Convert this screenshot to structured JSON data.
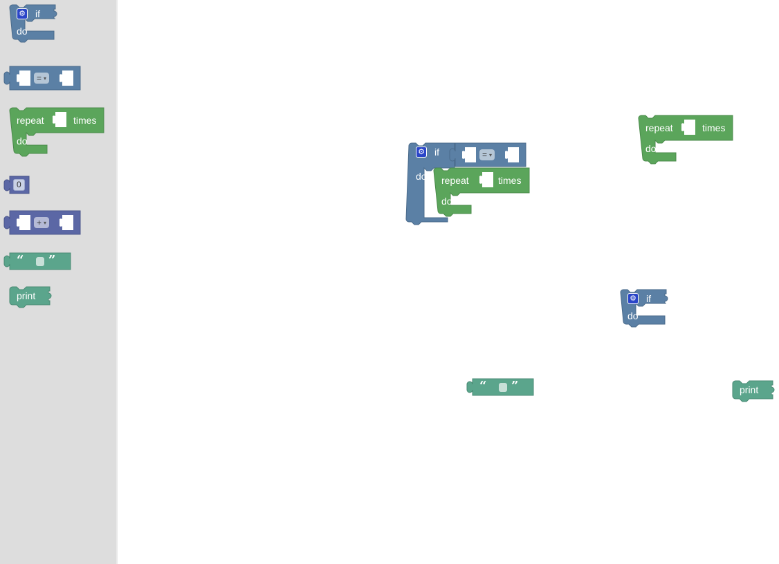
{
  "colors": {
    "logic": "#5b80a5",
    "loop": "#5ba55b",
    "math": "#5b67a5",
    "text": "#5ba58c",
    "toolbox_bg": "#dddddd",
    "workspace_bg": "#ffffff"
  },
  "toolbox": {
    "if_block": {
      "if_label": "if",
      "do_label": "do",
      "icon": "gear-icon"
    },
    "compare_block": {
      "operator": "="
    },
    "repeat_block": {
      "repeat_label": "repeat",
      "times_label": "times",
      "do_label": "do"
    },
    "number_block": {
      "value": "0"
    },
    "arithmetic_block": {
      "operator": "+"
    },
    "text_block": {
      "open_quote": "“",
      "close_quote": "”"
    },
    "print_block": {
      "label": "print"
    }
  },
  "workspace": {
    "if_group": {
      "if_label": "if",
      "do_label": "do",
      "operator": "=",
      "repeat_label": "repeat",
      "times_label": "times",
      "inner_do_label": "do"
    },
    "repeat_block": {
      "repeat_label": "repeat",
      "times_label": "times",
      "do_label": "do"
    },
    "if_block": {
      "if_label": "if",
      "do_label": "do"
    },
    "text_block": {
      "open_quote": "“",
      "close_quote": "”"
    },
    "print_block": {
      "label": "print"
    }
  }
}
